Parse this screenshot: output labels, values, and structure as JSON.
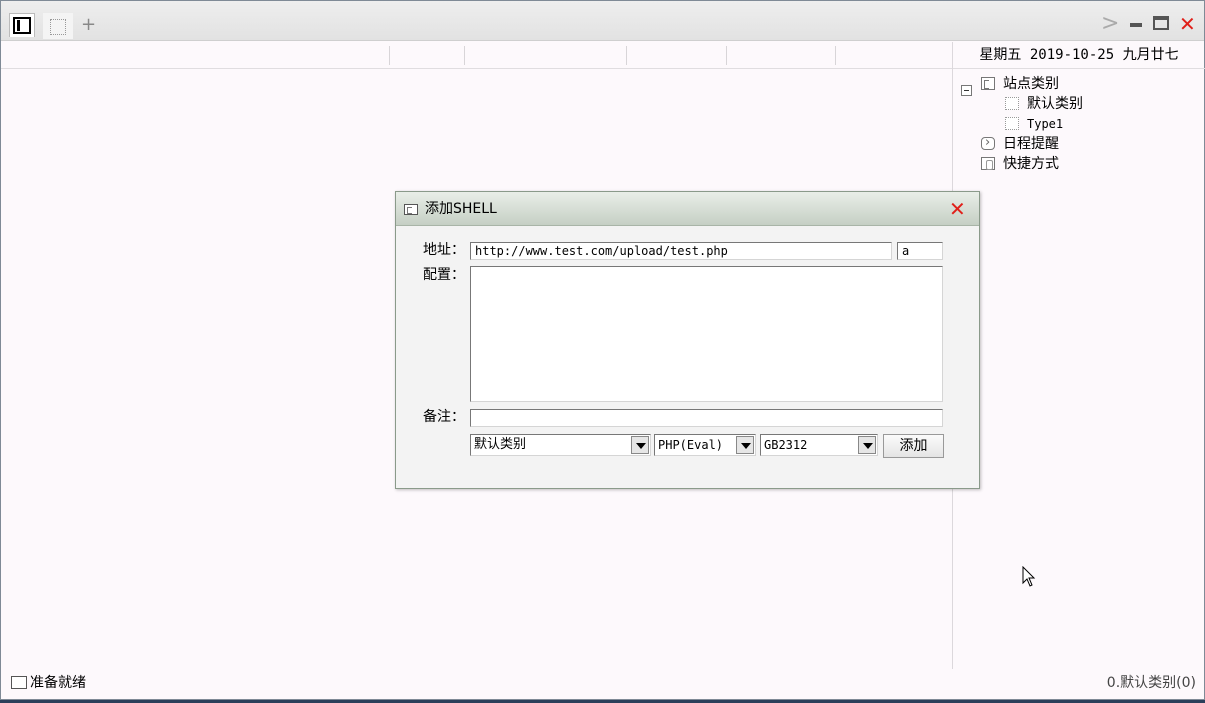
{
  "titlebar": {
    "tab_add_glyph": "+",
    "chevron_glyph": ">",
    "close_glyph": "✕"
  },
  "date_bar": "星期五 2019-10-25 九月廿七",
  "tree": {
    "root": "站点类别",
    "children": [
      "默认类别",
      "Type1"
    ],
    "others": [
      "日程提醒",
      "快捷方式"
    ]
  },
  "dialog": {
    "title": "添加SHELL",
    "close_glyph": "✕",
    "address_label": "地址：",
    "address_value": "http://www.test.com/upload/test.php",
    "password_value": "a",
    "config_label": "配置：",
    "config_value": "",
    "note_label": "备注：",
    "note_value": "",
    "category_select": "默认类别",
    "type_select": "PHP(Eval)",
    "encoding_select": "GB2312",
    "add_button": "添加"
  },
  "status": {
    "left": "准备就绪",
    "right": "0.默认类别(0)"
  }
}
